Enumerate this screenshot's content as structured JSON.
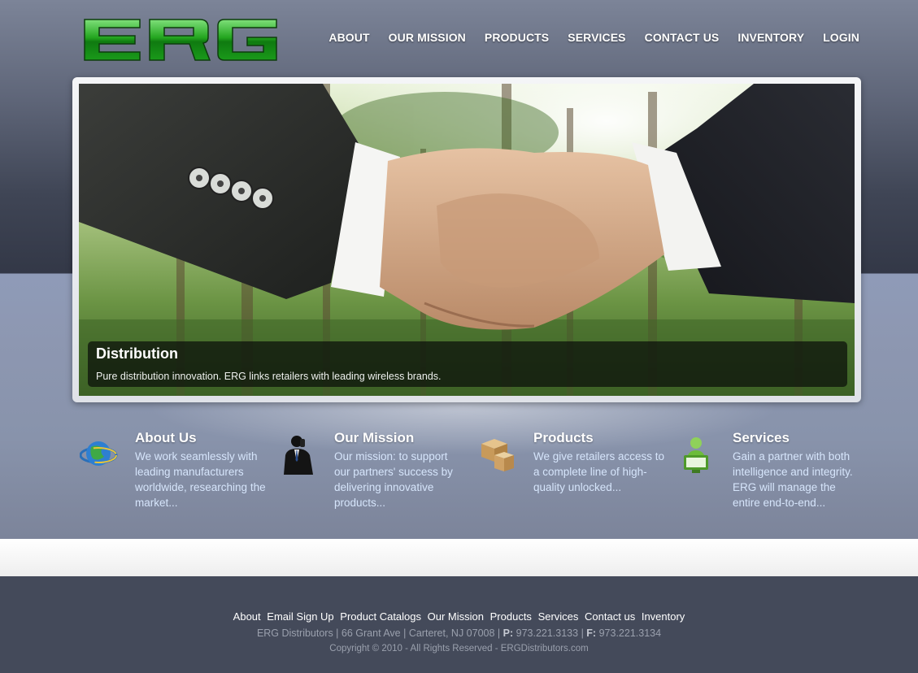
{
  "brand": {
    "logo_text": "ERG",
    "logo_color": "#1fa31c"
  },
  "nav": {
    "items": [
      {
        "label": "ABOUT"
      },
      {
        "label": "OUR MISSION"
      },
      {
        "label": "PRODUCTS"
      },
      {
        "label": "SERVICES"
      },
      {
        "label": "CONTACT US"
      },
      {
        "label": "INVENTORY"
      },
      {
        "label": "LOGIN"
      }
    ]
  },
  "hero": {
    "title": "Distribution",
    "text": "Pure distribution innovation. ERG links retailers with leading wireless brands."
  },
  "features": [
    {
      "icon": "globe-icon",
      "title": "About Us",
      "text": "We work seamlessly with leading manufacturers worldwide, researching the market..."
    },
    {
      "icon": "businessman-phone-icon",
      "title": "Our Mission",
      "text": "Our mission: to support our partners' success by delivering innovative products..."
    },
    {
      "icon": "boxes-icon",
      "title": "Products",
      "text": "We give retailers access to a complete line of high-quality unlocked..."
    },
    {
      "icon": "user-computer-icon",
      "title": "Services",
      "text": "Gain a partner with both intelligence and integrity. ERG will manage the entire end-to-end..."
    }
  ],
  "footer": {
    "links": [
      {
        "label": "About"
      },
      {
        "label": "Email Sign Up"
      },
      {
        "label": "Product Catalogs"
      },
      {
        "label": "Our Mission"
      },
      {
        "label": "Products"
      },
      {
        "label": "Services"
      },
      {
        "label": "Contact us"
      },
      {
        "label": "Inventory"
      }
    ],
    "company": "ERG Distributors | 66 Grant Ave | Carteret, NJ 07008 |",
    "phone_label": "P:",
    "phone": "973.221.3133 |",
    "fax_label": "F:",
    "fax": "973.221.3134",
    "copyright": "Copyright © 2010 - All Rights Reserved - ERGDistributors.com"
  }
}
